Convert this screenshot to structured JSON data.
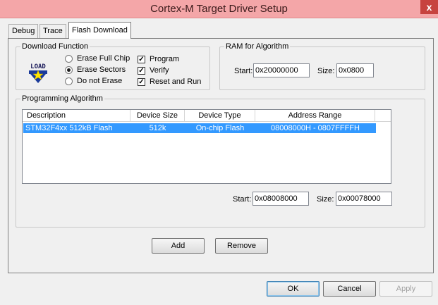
{
  "window": {
    "title": "Cortex-M Target Driver Setup",
    "close_glyph": "x"
  },
  "tabs": [
    {
      "label": "Debug"
    },
    {
      "label": "Trace"
    },
    {
      "label": "Flash Download"
    }
  ],
  "download_function": {
    "title": "Download Function",
    "icon_text": "LOAD",
    "radios": [
      {
        "label": "Erase Full Chip",
        "selected": false
      },
      {
        "label": "Erase Sectors",
        "selected": true
      },
      {
        "label": "Do not Erase",
        "selected": false
      }
    ],
    "checks": [
      {
        "label": "Program",
        "checked": true
      },
      {
        "label": "Verify",
        "checked": true
      },
      {
        "label": "Reset and Run",
        "checked": true
      }
    ]
  },
  "ram": {
    "title": "RAM for Algorithm",
    "start_label": "Start:",
    "start_value": "0x20000000",
    "size_label": "Size:",
    "size_value": "0x0800"
  },
  "programming": {
    "title": "Programming Algorithm",
    "columns": [
      "Description",
      "Device Size",
      "Device Type",
      "Address Range"
    ],
    "rows": [
      {
        "description": "STM32F4xx 512kB Flash",
        "size": "512k",
        "type": "On-chip Flash",
        "range": "08008000H - 0807FFFFH"
      }
    ],
    "start_label": "Start:",
    "start_value": "0x08008000",
    "size_label": "Size:",
    "size_value": "0x00078000"
  },
  "buttons": {
    "add": "Add",
    "remove": "Remove",
    "ok": "OK",
    "cancel": "Cancel",
    "apply": "Apply"
  },
  "colors": {
    "selection": "#3399ff",
    "titlebar": "#f4a6a8",
    "close": "#c7433f"
  }
}
